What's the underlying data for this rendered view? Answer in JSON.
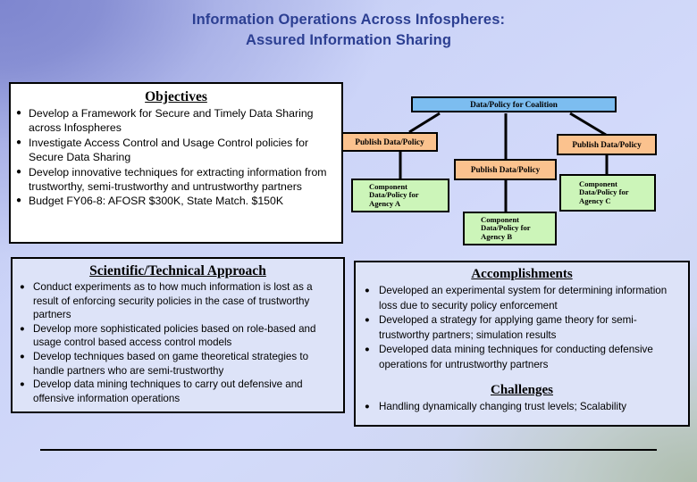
{
  "slide": {
    "title_line1": "Information Operations Across Infospheres:",
    "title_line2": "Assured Information Sharing",
    "title_color": "#2c3f92",
    "background_colors": [
      "#7e86cf",
      "#ccd4f8",
      "#acbcaa"
    ]
  },
  "objectives": {
    "heading": "Objectives",
    "bullet_glyph": "●",
    "items": [
      "Develop a Framework for Secure and Timely Data Sharing across Infospheres",
      "Investigate Access Control and Usage Control policies for Secure Data Sharing",
      "Develop innovative techniques for extracting information from trustworthy, semi-trustworthy and untrustworthy partners",
      "Budget FY06-8: AFOSR $300K, State Match. $150K"
    ]
  },
  "approach": {
    "heading": "Scientific/Technical Approach",
    "bullet_glyph": "●",
    "items": [
      "Conduct experiments as to how much information is lost as a result of enforcing security policies in the case of trustworthy partners",
      "Develop more sophisticated policies based on role-based and  usage control based access control models",
      "Develop techniques based on game theoretical strategies to handle partners who are semi-trustworthy",
      "Develop data mining techniques to carry out defensive and offensive information operations"
    ]
  },
  "accomplishments": {
    "heading": "Accomplishments",
    "bullet_glyph": "●",
    "items": [
      "Developed an experimental system for determining information loss due to security policy enforcement",
      "Developed a strategy for applying game theory for semi-trustworthy partners; simulation results",
      "Developed data mining techniques for conducting defensive operations for untrustworthy partners"
    ]
  },
  "challenges": {
    "heading": "Challenges",
    "bullet_glyph": "●",
    "items": [
      "Handling dynamically changing trust levels; Scalability"
    ]
  },
  "diagram": {
    "coalition": "Data/Policy for Coalition",
    "publish_a": "Publish Data/Policy",
    "publish_b": "Publish Data/Policy",
    "publish_c": "Publish Data/Policy",
    "component_a_line1": "Component",
    "component_a_line2": "Data/Policy for",
    "component_a_line3": "Agency A",
    "component_b_line1": "Component",
    "component_b_line2": "Data/Policy for",
    "component_b_line3": "Agency B",
    "component_c_line1": "Component",
    "component_c_line2": "Data/Policy for",
    "component_c_line3": "Agency C",
    "colors": {
      "coalition": "#7cbdf0",
      "publish": "#fbc28e",
      "component": "#ccf5b9",
      "connector": "#000000"
    }
  }
}
